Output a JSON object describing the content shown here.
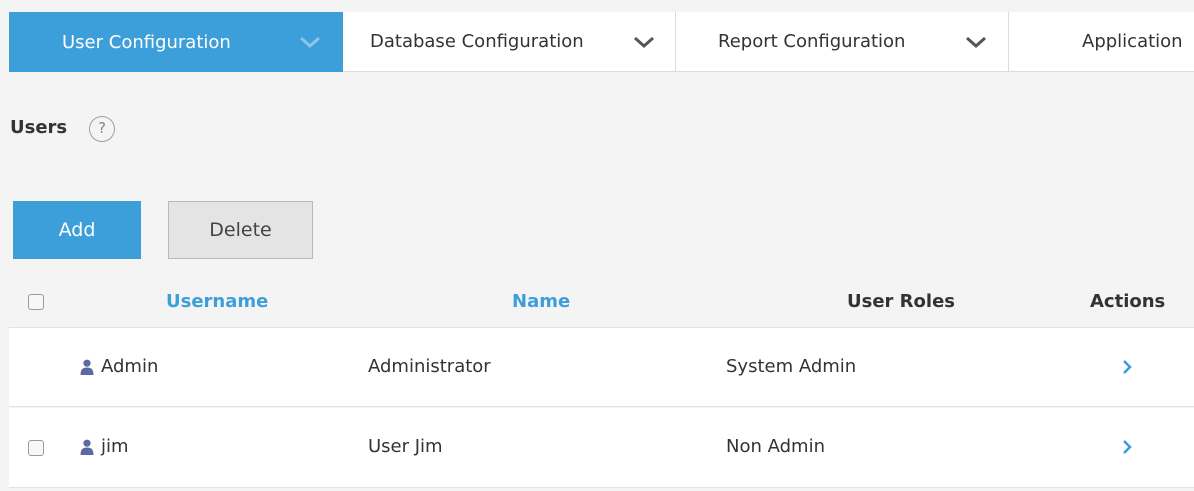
{
  "tabs": [
    {
      "label": "User Configuration",
      "active": true
    },
    {
      "label": "Database Configuration",
      "active": false
    },
    {
      "label": "Report Configuration",
      "active": false
    },
    {
      "label": "Application",
      "active": false
    }
  ],
  "section": {
    "title": "Users",
    "help_symbol": "?"
  },
  "buttons": {
    "add_label": "Add",
    "delete_label": "Delete"
  },
  "table": {
    "columns": [
      "Username",
      "Name",
      "User Roles",
      "Actions"
    ],
    "rows": [
      {
        "username": "Admin",
        "name": "Administrator",
        "role": "System Admin",
        "has_checkbox": false
      },
      {
        "username": "jim",
        "name": "User Jim",
        "role": "Non Admin",
        "has_checkbox": true
      }
    ]
  },
  "colors": {
    "accent": "#3d9fd9",
    "user_icon": "#5b6aa0",
    "background": "#f4f4f4"
  },
  "icons": {
    "tab_dropdown": "chevron-down-icon",
    "row_action": "chevron-right-icon",
    "user": "user-icon",
    "help": "help-icon"
  }
}
